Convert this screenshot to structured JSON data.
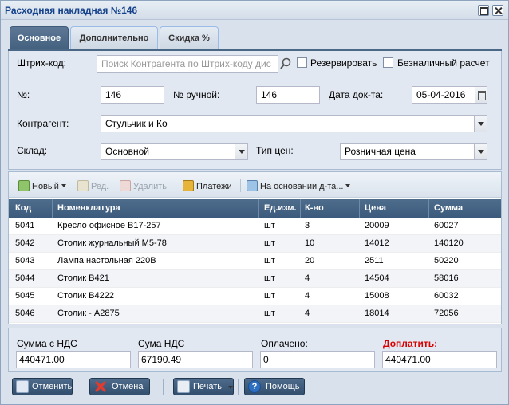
{
  "window": {
    "title": "Расходная накладная №146"
  },
  "tabs": [
    {
      "label": "Основное"
    },
    {
      "label": "Дополнительно"
    },
    {
      "label": "Скидка %"
    }
  ],
  "form": {
    "barcode_label": "Штрих-код:",
    "barcode_placeholder": "Поиск Контрагента по Штрих-коду дис",
    "reserve_label": "Резервировать",
    "cashless_label": "Безналичный расчет",
    "number_label": "№:",
    "number_value": "146",
    "manual_label": "№ ручной:",
    "manual_value": "146",
    "date_label": "Дата док-та:",
    "date_value": "05-04-2016",
    "contractor_label": "Контрагент:",
    "contractor_value": "Стульчик и Ко",
    "warehouse_label": "Склад:",
    "warehouse_value": "Основной",
    "price_type_label": "Тип цен:",
    "price_type_value": "Розничная цена"
  },
  "toolbar": {
    "new_label": "Новый",
    "edit_label": "Ред.",
    "delete_label": "Удалить",
    "payments_label": "Платежи",
    "based_on_label": "На основании д-та..."
  },
  "grid": {
    "columns": [
      "Код",
      "Номенклатура",
      "Ед.изм.",
      "К-во",
      "Цена",
      "Сумма"
    ],
    "rows": [
      [
        "5041",
        "Кресло офисное В17-257",
        "шт",
        "3",
        "20009",
        "60027"
      ],
      [
        "5042",
        "Столик журнальный М5-78",
        "шт",
        "10",
        "14012",
        "140120"
      ],
      [
        "5043",
        "Лампа настольная 220В",
        "шт",
        "20",
        "2511",
        "50220"
      ],
      [
        "5044",
        "Столик В421",
        "шт",
        "4",
        "14504",
        "58016"
      ],
      [
        "5045",
        "Столик В4222",
        "шт",
        "4",
        "15008",
        "60032"
      ],
      [
        "5046",
        "Столик - А2875",
        "шт",
        "4",
        "18014",
        "72056"
      ]
    ]
  },
  "totals": {
    "sum_vat_label": "Сумма с НДС",
    "sum_vat_value": "440471.00",
    "vat_label": "Сума НДС",
    "vat_value": "67190.49",
    "paid_label": "Оплачено:",
    "paid_value": "0",
    "topay_label": "Доплатить:",
    "topay_value": "440471.00"
  },
  "footer": {
    "post_cancel_label": "Отменить",
    "cancel_label": "Отмена",
    "print_label": "Печать",
    "help_label": "Помощь"
  }
}
